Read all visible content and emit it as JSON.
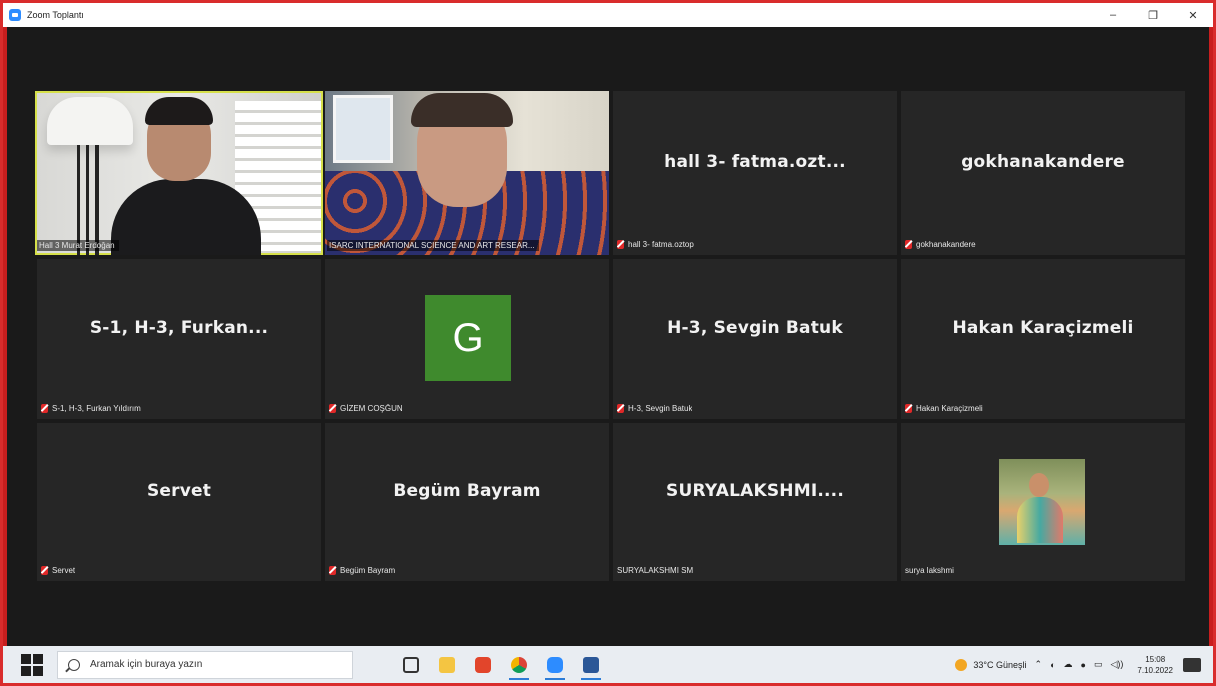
{
  "window": {
    "title": "Zoom Toplantı",
    "controls": [
      "–",
      "❐",
      "✕"
    ]
  },
  "participants": [
    {
      "label": "Hall 3 Murat Erdoğan",
      "type": "video",
      "muted": false
    },
    {
      "label": "ISARC INTERNATIONAL SCIENCE AND ART RESEAR...",
      "type": "video",
      "muted": false
    },
    {
      "display": "hall 3- fatma.ozt...",
      "label": "hall 3- fatma.oztop",
      "type": "name",
      "muted": true
    },
    {
      "display": "gokhanakandere",
      "label": "gokhanakandere",
      "type": "name",
      "muted": true
    },
    {
      "display": "S-1, H-3, Furkan...",
      "label": "S-1, H-3, Furkan Yıldırım",
      "type": "name",
      "muted": true
    },
    {
      "avatar_letter": "G",
      "label": "GİZEM COŞĞUN",
      "type": "avatar",
      "muted": true
    },
    {
      "display": "H-3, Sevgin Batuk",
      "label": "H-3, Sevgin Batuk",
      "type": "name",
      "muted": true
    },
    {
      "display": "Hakan Karaçizmeli",
      "label": "Hakan Karaçizmeli",
      "type": "name",
      "muted": true
    },
    {
      "display": "Servet",
      "label": "Servet",
      "type": "name",
      "muted": true
    },
    {
      "display": "Begüm Bayram",
      "label": "Begüm Bayram",
      "type": "name",
      "muted": true
    },
    {
      "display": "SURYALAKSHMI....",
      "label": "SURYALAKSHMI SM",
      "type": "name",
      "muted": false
    },
    {
      "label": "surya lakshmi",
      "type": "photo",
      "muted": false
    }
  ],
  "taskbar": {
    "search_placeholder": "Aramak için buraya yazın",
    "weather": "33°C Güneşli",
    "time": "15:08",
    "date": "7.10.2022"
  },
  "colors": {
    "frame": "#d92c2c",
    "stage": "#1a1a1a",
    "tile": "#262626",
    "active_speaker": "#d6e04a",
    "muted_icon": "#e02828",
    "avatar_bg": "#3f8a2d"
  }
}
